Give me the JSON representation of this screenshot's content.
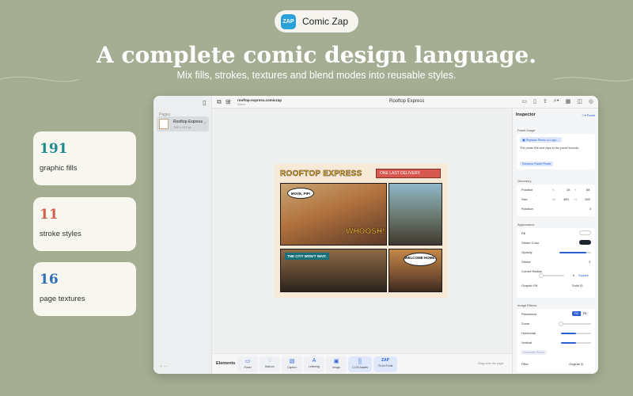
{
  "brand": {
    "logo_text": "ZAP",
    "name": "Comic Zap"
  },
  "hero": {
    "headline": "A complete comic design language.",
    "subline": "Mix fills, strokes, textures and blend modes into reusable styles."
  },
  "stats": [
    {
      "value": "191",
      "label": "graphic fills",
      "color": "#1d8a8c"
    },
    {
      "value": "11",
      "label": "stroke styles",
      "color": "#d0614f"
    },
    {
      "value": "16",
      "label": "page textures",
      "color": "#2e6fb8"
    }
  ],
  "window": {
    "doc_name": "rooftop-express.comiczap",
    "doc_status": "Edited",
    "title": "Rooftop Express",
    "sidebar": {
      "pages_label": "Pages",
      "page": {
        "title": "Rooftop Express",
        "size": "765 × 615 pt"
      }
    },
    "comic": {
      "title": "ROOFTOP EXPRESS",
      "banner": "ONE LAST DELIVERY.",
      "bubble1": "MOVE, PIP!",
      "sfx": "WHOOSH!",
      "caption": "THE CITY WON'T WAIT.",
      "bubble2": "WELCOME HOME."
    },
    "elements": {
      "label": "Elements",
      "tools": [
        {
          "label": "Panel",
          "icon": "panel-icon",
          "glyph": "▭"
        },
        {
          "label": "Balloon",
          "icon": "balloon-icon",
          "glyph": "💬"
        },
        {
          "label": "Caption",
          "icon": "caption-icon",
          "glyph": "▤"
        },
        {
          "label": "Lettering",
          "icon": "lettering-icon",
          "glyph": "A"
        },
        {
          "label": "Image",
          "icon": "image-icon",
          "glyph": "▣"
        },
        {
          "label": "1,100 Assets",
          "icon": "assets-icon",
          "glyph": "⣿"
        },
        {
          "label": "75 Art Fonts",
          "icon": "art-fonts-icon",
          "glyph": "ZAP"
        }
      ],
      "drag_hint": "Drag onto the page"
    },
    "inspector": {
      "title": "Inspector",
      "panel_tag": "Panel",
      "panel_image": {
        "section": "Panel Image",
        "replace": "Replace Photo or Logo…",
        "note": "The photo fills and clips to the panel bounds.",
        "remove": "Remove Panel Photo"
      },
      "geometry": {
        "section": "Geometry",
        "position_label": "Position",
        "x_label": "X",
        "x": "28",
        "y_label": "Y",
        "y": "88",
        "size_label": "Size",
        "w_label": "W",
        "w": "480",
        "h_label": "H",
        "h": "266",
        "rotation_label": "Rotation",
        "rotation": "0"
      },
      "appearance": {
        "section": "Appearance",
        "fill": "Fill",
        "stroke_color": "Stroke Color",
        "opacity": "Opacity",
        "opacity_value": 0.85,
        "stroke": "Stroke",
        "stroke_value": "3",
        "corner_radius": "Corner Radius",
        "corner_value": "0",
        "corner_shape": "Square",
        "graphic_fill": "Graphic Fill",
        "graphic_fill_value": "Solid",
        "fill_color": "#ffffff",
        "stroke_color_value": "#1c2430"
      },
      "image_effects": {
        "section": "Image Effects",
        "placement": "Placement",
        "fill_opt": "Fill",
        "fit_opt": "Fit",
        "zoom": "Zoom",
        "horizontal": "Horizontal",
        "vertical": "Vertical",
        "generate": "Generate Photo",
        "filter": "Filter",
        "filter_value": "Original",
        "zoom_value": 0.0,
        "horizontal_value": 0.5,
        "vertical_value": 0.5
      }
    }
  }
}
